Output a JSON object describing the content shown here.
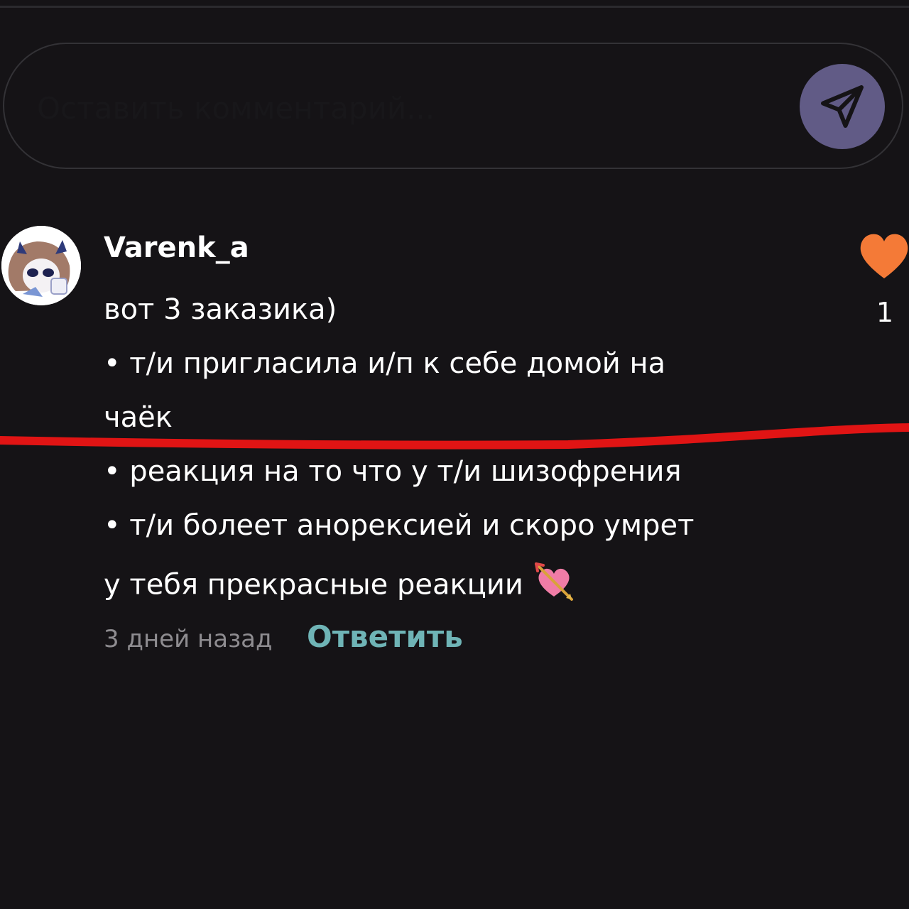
{
  "comment_box": {
    "placeholder": "Оставить комментарий..."
  },
  "send_button": {
    "icon": "send-arrow-icon",
    "color": "#615b86"
  },
  "comment": {
    "username": "Varenk_a",
    "lines": [
      "вот 3 заказика)",
      "• т/и пригласила и/п к себе домой на",
      "чаёк",
      "• реакция на то что у т/и шизофрения",
      "• т/и болеет анорексией и скоро умрет",
      "у тебя прекрасные реакции"
    ],
    "emoji": "heart-with-arrow-icon",
    "timestamp": "3 дней назад",
    "reply_label": "Ответить",
    "like_count": "1",
    "like_color": "#f47a37",
    "reply_color": "#6fb4b6"
  },
  "annotation": {
    "color": "#e01414"
  }
}
